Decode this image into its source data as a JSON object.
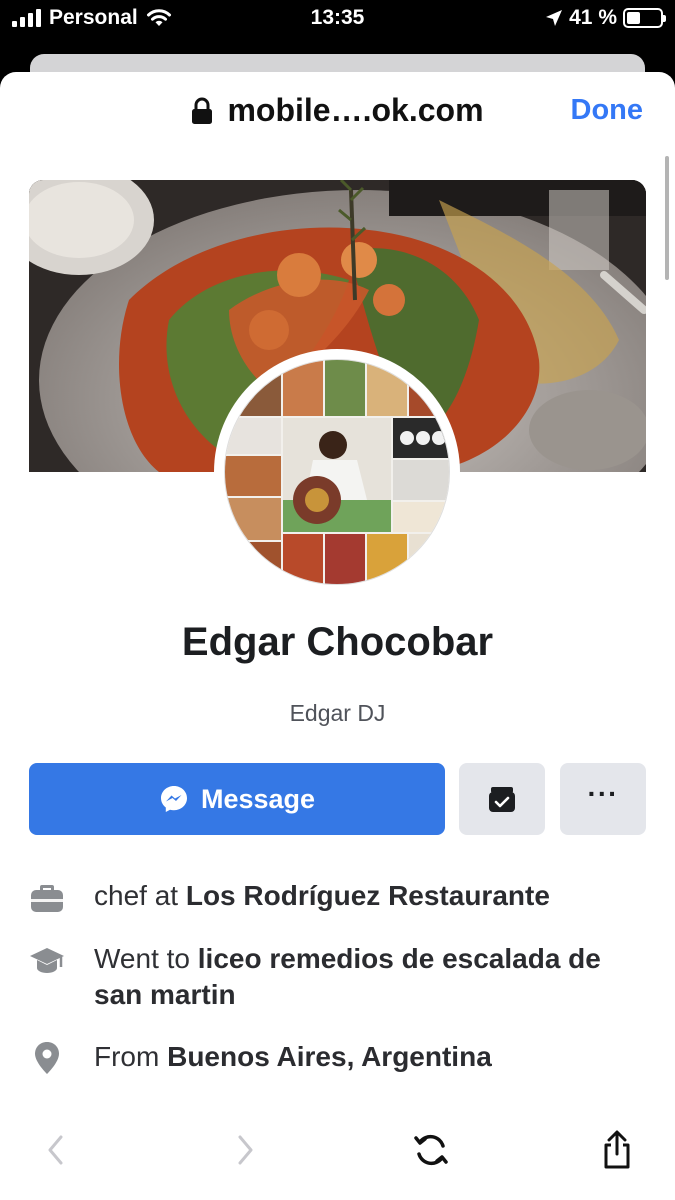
{
  "status_bar": {
    "carrier": "Personal",
    "time": "13:35",
    "battery_percent_label": "41 %",
    "battery_level": 0.41
  },
  "browser": {
    "url": "mobile….ok.com",
    "done_label": "Done"
  },
  "profile": {
    "name": "Edgar Chocobar",
    "nickname": "Edgar DJ"
  },
  "actions": {
    "message_label": "Message"
  },
  "intro": {
    "work": {
      "prefix": "chef at ",
      "value": "Los Rodríguez Restaurante",
      "icon": "briefcase-icon"
    },
    "education": {
      "prefix": "Went to ",
      "value": "liceo remedios de escalada de san martin",
      "icon": "graduation-cap-icon"
    },
    "hometown": {
      "prefix": "From ",
      "value": "Buenos Aires, Argentina",
      "icon": "location-pin-icon"
    }
  },
  "colors": {
    "accent": "#3578e5",
    "ios_link": "#3478f6",
    "secondary_button": "#e4e6eb",
    "icon_gray": "#8a8d91"
  }
}
